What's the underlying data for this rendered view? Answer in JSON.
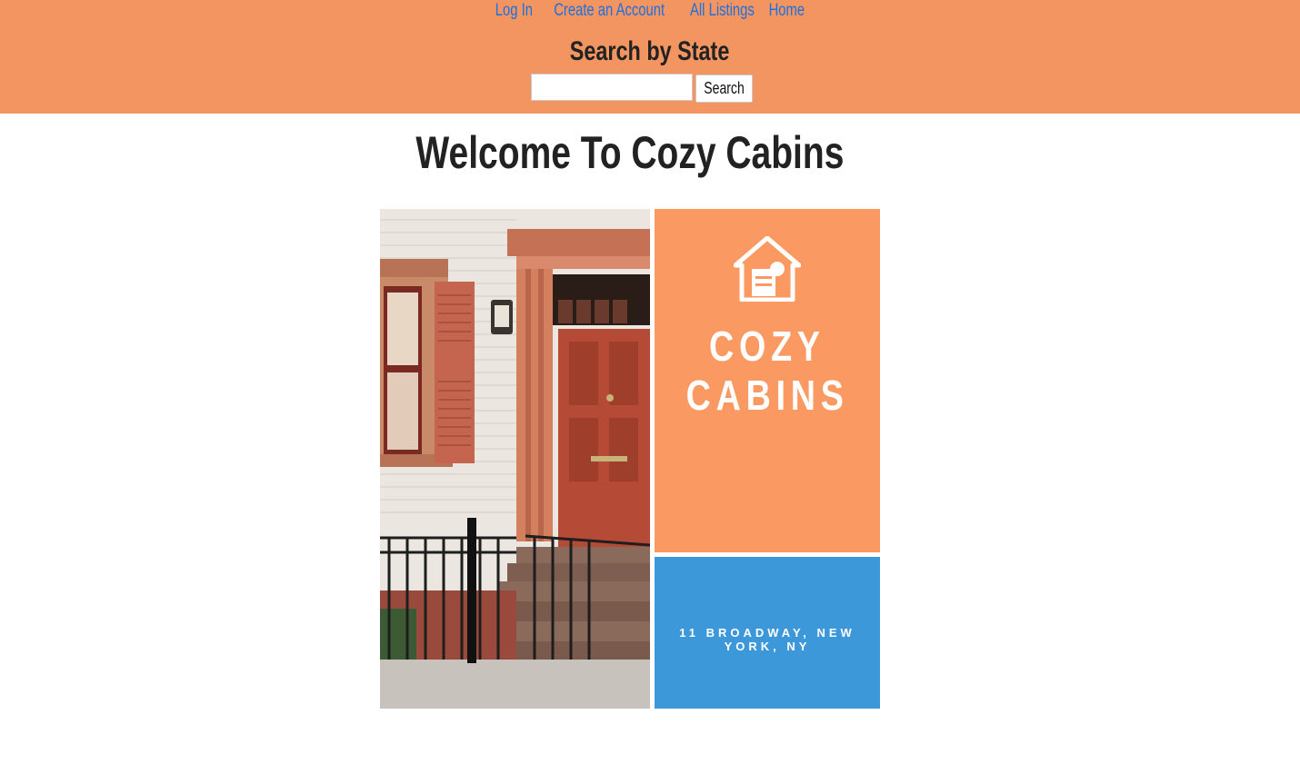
{
  "nav": {
    "items": [
      {
        "label": "Log In"
      },
      {
        "label": "Create an Account"
      },
      {
        "label": "All Listings"
      },
      {
        "label": "Home"
      }
    ]
  },
  "search": {
    "title": "Search by State",
    "input_value": "",
    "button_label": "Search"
  },
  "main": {
    "heading": "Welcome To Cozy Cabins"
  },
  "poster": {
    "brand_line_1": "COZY",
    "brand_line_2": "CABINS",
    "address": "11 BROADWAY, NEW YORK, NY",
    "icon": "house-logo-icon"
  },
  "colors": {
    "header_bg": "#f29561",
    "nav_link": "#1e6fe0",
    "poster_orange": "#fa9a62",
    "poster_blue": "#3d98d9",
    "door_red": "#b54a36"
  }
}
